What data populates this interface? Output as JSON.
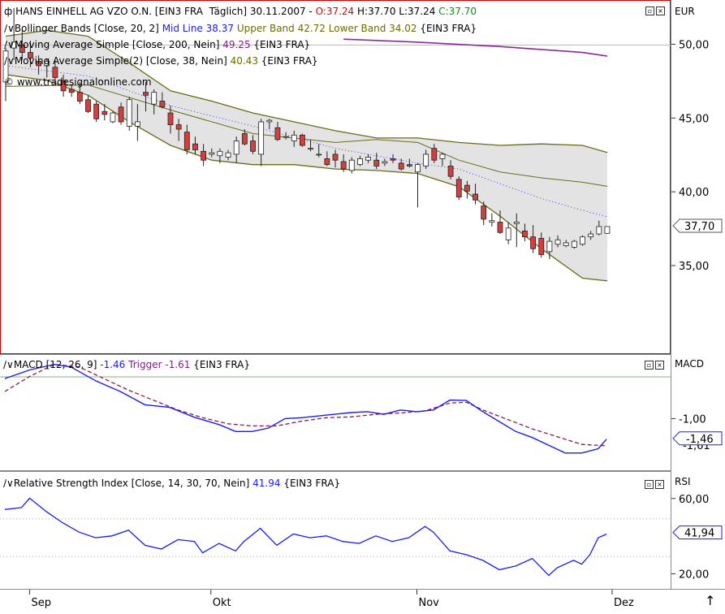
{
  "price_panel": {
    "title_symbol": "HANS EINHELL AG VZO O.N. [EIN3 FRA  Täglich] 30.11.2007 - ",
    "open": "O:37.24",
    "high_low": "H:37.70 L:37.24",
    "close": "C:37.70",
    "bb_label": "Bollinger Bands [Close, 20, 2]",
    "bb_mid": "Mid Line 38.37",
    "bb_upper_lower": "Upper Band 42.72 Lower Band 34.02",
    "bb_suffix": "{EIN3 FRA}",
    "ma200_label": "Moving Average Simple [Close, 200, Nein]",
    "ma200_value": "49.25",
    "ma200_suffix": "{EIN3 FRA}",
    "ma38_label": "Moving Average Simple(2) [Close, 38, Nein]",
    "ma38_value": "40.43",
    "ma38_suffix": "{EIN3 FRA}",
    "copyright": "© www.tradesignalonline.com",
    "axis_unit": "EUR",
    "ticks": [
      "50,00",
      "45,00",
      "40,00",
      "35,00"
    ],
    "last_price": "37,70"
  },
  "macd_panel": {
    "label": "MACD [12, 26, 9]",
    "macd_value": "-1.46",
    "trigger_label": "Trigger",
    "trigger_value": "-1.61",
    "suffix": "{EIN3 FRA}",
    "axis_unit": "MACD",
    "ticks": [
      "-1,00"
    ],
    "last_value": "-1,46",
    "hidden_value": "-1,61"
  },
  "rsi_panel": {
    "label": "Relative Strength Index [Close, 14, 30, 70, Nein]",
    "rsi_value": "41.94",
    "suffix": "{EIN3 FRA}",
    "axis_unit": "RSI",
    "ticks": [
      "60,00",
      "20,00"
    ],
    "last_value": "41,94"
  },
  "x_axis": {
    "labels": [
      "Sep",
      "Okt",
      "Nov",
      "Dez"
    ]
  },
  "colors": {
    "macd": "#1a1aff",
    "trigger": "#8a1a4a",
    "rsi": "#1a1aff",
    "band": "#6b6b1a",
    "ma200": "#8a2a9a",
    "down": "#d04040",
    "up": "#ffffff"
  },
  "chart_data": [
    {
      "type": "candlestick",
      "title": "HANS EINHELL AG VZO O.N. [EIN3 FRA  Täglich] 30.11.2007",
      "ylabel": "EUR",
      "ylim": [
        29.0,
        53.0
      ],
      "x_ticks": [
        "Sep",
        "Okt",
        "Nov",
        "Dez"
      ],
      "candles": [
        [
          47.5,
          49.8,
          46.2,
          49.6
        ],
        [
          49.8,
          52.5,
          49.0,
          50.2
        ],
        [
          50.0,
          51.0,
          49.0,
          49.5
        ],
        [
          49.5,
          50.3,
          48.5,
          49.1
        ],
        [
          48.9,
          49.3,
          48.0,
          48.6
        ],
        [
          48.6,
          49.1,
          47.8,
          48.9
        ],
        [
          48.5,
          49.0,
          47.5,
          47.8
        ],
        [
          47.6,
          48.0,
          46.5,
          46.9
        ],
        [
          47.0,
          47.3,
          46.5,
          46.8
        ],
        [
          46.8,
          47.5,
          46.0,
          46.2
        ],
        [
          46.3,
          46.6,
          45.4,
          45.5
        ],
        [
          46.0,
          46.2,
          44.8,
          45.0
        ],
        [
          45.5,
          46.0,
          44.9,
          45.3
        ],
        [
          44.8,
          45.5,
          44.7,
          45.4
        ],
        [
          45.8,
          46.1,
          44.6,
          44.8
        ],
        [
          44.5,
          46.5,
          44.2,
          46.3
        ],
        [
          44.5,
          46.0,
          43.5,
          44.8
        ],
        [
          46.8,
          47.5,
          45.5,
          46.6
        ],
        [
          46.0,
          47.0,
          45.3,
          46.8
        ],
        [
          46.2,
          46.8,
          45.7,
          45.8
        ],
        [
          45.4,
          45.9,
          44.0,
          44.6
        ],
        [
          44.6,
          45.0,
          43.5,
          44.3
        ],
        [
          44.1,
          44.6,
          42.6,
          42.9
        ],
        [
          43.3,
          43.8,
          42.6,
          42.9
        ],
        [
          42.8,
          43.3,
          41.8,
          42.2
        ],
        [
          42.6,
          43.0,
          42.4,
          42.7
        ],
        [
          42.5,
          43.0,
          42.0,
          42.8
        ],
        [
          42.4,
          42.9,
          42.2,
          42.7
        ],
        [
          42.6,
          43.8,
          42.0,
          43.5
        ],
        [
          44.0,
          44.3,
          43.2,
          43.3
        ],
        [
          43.5,
          43.9,
          42.6,
          42.8
        ],
        [
          42.6,
          45.0,
          41.8,
          44.8
        ],
        [
          44.8,
          45.0,
          44.3,
          44.9
        ],
        [
          44.4,
          44.8,
          43.5,
          43.6
        ],
        [
          43.8,
          44.1,
          43.6,
          43.8
        ],
        [
          43.5,
          44.2,
          43.1,
          43.9
        ],
        [
          43.9,
          44.0,
          43.1,
          43.2
        ],
        [
          43.0,
          43.6,
          42.8,
          43.0
        ],
        [
          42.6,
          43.3,
          42.4,
          42.6
        ],
        [
          42.3,
          42.8,
          41.8,
          41.9
        ],
        [
          42.6,
          42.9,
          41.7,
          42.2
        ],
        [
          42.1,
          42.6,
          41.4,
          41.6
        ],
        [
          41.5,
          42.4,
          41.3,
          42.2
        ],
        [
          41.9,
          42.5,
          41.8,
          42.3
        ],
        [
          42.2,
          42.6,
          42.0,
          42.4
        ],
        [
          42.2,
          42.7,
          41.6,
          41.8
        ],
        [
          42.0,
          42.3,
          41.8,
          42.1
        ],
        [
          42.3,
          42.6,
          42.0,
          42.2
        ],
        [
          42.0,
          42.3,
          41.5,
          41.6
        ],
        [
          41.9,
          42.3,
          41.7,
          41.8
        ],
        [
          41.4,
          42.0,
          39.0,
          41.9
        ],
        [
          41.8,
          42.9,
          41.6,
          42.6
        ],
        [
          43.0,
          43.3,
          42.0,
          42.2
        ],
        [
          42.3,
          42.7,
          41.8,
          42.6
        ],
        [
          41.8,
          42.2,
          40.9,
          41.1
        ],
        [
          40.9,
          41.1,
          39.5,
          39.7
        ],
        [
          40.5,
          40.8,
          39.6,
          40.1
        ],
        [
          39.9,
          40.6,
          39.2,
          39.5
        ],
        [
          39.1,
          39.4,
          37.8,
          38.2
        ],
        [
          38.0,
          38.6,
          37.7,
          38.1
        ],
        [
          38.0,
          38.8,
          37.2,
          37.3
        ],
        [
          36.8,
          38.0,
          36.5,
          37.6
        ],
        [
          37.9,
          38.6,
          36.3,
          38.0
        ],
        [
          37.4,
          37.9,
          36.7,
          37.0
        ],
        [
          37.0,
          37.8,
          35.9,
          36.2
        ],
        [
          36.9,
          37.3,
          35.6,
          35.8
        ],
        [
          36.0,
          37.0,
          35.5,
          36.7
        ],
        [
          36.5,
          37.1,
          36.3,
          36.8
        ],
        [
          36.4,
          36.8,
          36.3,
          36.6
        ],
        [
          36.3,
          36.8,
          36.2,
          36.7
        ],
        [
          36.5,
          37.1,
          36.4,
          37.0
        ],
        [
          37.0,
          37.4,
          36.8,
          37.2
        ],
        [
          37.2,
          38.1,
          37.1,
          37.7
        ],
        [
          37.24,
          37.7,
          37.24,
          37.7
        ]
      ],
      "series": [
        {
          "name": "Bollinger Upper Band",
          "values": [
            [
              0,
              50.6
            ],
            [
              5,
              51.0
            ],
            [
              10,
              50.6
            ],
            [
              15,
              48.8
            ],
            [
              20,
              46.9
            ],
            [
              25,
              46.2
            ],
            [
              30,
              45.4
            ],
            [
              35,
              44.8
            ],
            [
              40,
              44.2
            ],
            [
              45,
              43.7
            ],
            [
              50,
              43.7
            ],
            [
              55,
              43.4
            ],
            [
              60,
              43.2
            ],
            [
              65,
              43.3
            ],
            [
              70,
              43.2
            ],
            [
              73,
              42.72
            ]
          ]
        },
        {
          "name": "Bollinger Lower Band",
          "values": [
            [
              0,
              48.0
            ],
            [
              5,
              47.6
            ],
            [
              10,
              46.6
            ],
            [
              15,
              44.8
            ],
            [
              20,
              43.2
            ],
            [
              25,
              42.2
            ],
            [
              30,
              41.9
            ],
            [
              35,
              41.9
            ],
            [
              40,
              41.6
            ],
            [
              45,
              41.5
            ],
            [
              50,
              41.3
            ],
            [
              55,
              40.4
            ],
            [
              60,
              38.4
            ],
            [
              65,
              36.2
            ],
            [
              70,
              34.2
            ],
            [
              73,
              34.02
            ]
          ]
        },
        {
          "name": "Mid Line",
          "values": [
            [
              0,
              48.6
            ],
            [
              10,
              47.9
            ],
            [
              20,
              45.9
            ],
            [
              30,
              44.5
            ],
            [
              40,
              43.0
            ],
            [
              50,
              42.0
            ],
            [
              55,
              41.6
            ],
            [
              60,
              40.6
            ],
            [
              65,
              39.6
            ],
            [
              70,
              38.8
            ],
            [
              73,
              38.37
            ]
          ]
        },
        {
          "name": "Moving Average Simple(2)",
          "values": [
            [
              0,
              47.2
            ],
            [
              10,
              47.3
            ],
            [
              20,
              45.6
            ],
            [
              30,
              44.0
            ],
            [
              40,
              43.4
            ],
            [
              45,
              43.6
            ],
            [
              50,
              43.4
            ],
            [
              55,
              42.2
            ],
            [
              60,
              41.4
            ],
            [
              65,
              41.0
            ],
            [
              70,
              40.7
            ],
            [
              73,
              40.43
            ]
          ]
        },
        {
          "name": "Moving Average Simple",
          "values": [
            [
              41,
              50.4
            ],
            [
              50,
              50.2
            ],
            [
              60,
              49.9
            ],
            [
              70,
              49.5
            ],
            [
              73,
              49.25
            ]
          ]
        }
      ]
    },
    {
      "type": "line",
      "title": "MACD [12, 26, 9]",
      "ylabel": "MACD",
      "ylim": [
        -2.2,
        0.5
      ],
      "series": [
        {
          "name": "MACD",
          "values": [
            [
              0,
              -0.05
            ],
            [
              3,
              0.15
            ],
            [
              6,
              0.28
            ],
            [
              8,
              0.22
            ],
            [
              11,
              -0.1
            ],
            [
              14,
              -0.35
            ],
            [
              17,
              -0.66
            ],
            [
              20,
              -0.72
            ],
            [
              23,
              -0.95
            ],
            [
              26,
              -1.12
            ],
            [
              28,
              -1.28
            ],
            [
              30,
              -1.28
            ],
            [
              32,
              -1.2
            ],
            [
              34,
              -0.98
            ],
            [
              36,
              -0.96
            ],
            [
              38,
              -0.92
            ],
            [
              40,
              -0.88
            ],
            [
              42,
              -0.84
            ],
            [
              44,
              -0.82
            ],
            [
              46,
              -0.88
            ],
            [
              48,
              -0.78
            ],
            [
              50,
              -0.82
            ],
            [
              52,
              -0.78
            ],
            [
              54,
              -0.55
            ],
            [
              56,
              -0.56
            ],
            [
              58,
              -0.82
            ],
            [
              60,
              -1.05
            ],
            [
              62,
              -1.28
            ],
            [
              64,
              -1.42
            ],
            [
              66,
              -1.6
            ],
            [
              68,
              -1.78
            ],
            [
              70,
              -1.78
            ],
            [
              72,
              -1.68
            ],
            [
              73,
              -1.46
            ]
          ]
        },
        {
          "name": "Trigger",
          "values": [
            [
              0,
              -0.35
            ],
            [
              3,
              0.0
            ],
            [
              6,
              0.28
            ],
            [
              9,
              0.22
            ],
            [
              12,
              -0.05
            ],
            [
              15,
              -0.32
            ],
            [
              18,
              -0.55
            ],
            [
              21,
              -0.78
            ],
            [
              24,
              -0.96
            ],
            [
              27,
              -1.1
            ],
            [
              30,
              -1.15
            ],
            [
              33,
              -1.15
            ],
            [
              36,
              -1.04
            ],
            [
              39,
              -0.96
            ],
            [
              42,
              -0.94
            ],
            [
              45,
              -0.88
            ],
            [
              48,
              -0.85
            ],
            [
              51,
              -0.8
            ],
            [
              54,
              -0.62
            ],
            [
              56,
              -0.6
            ],
            [
              58,
              -0.78
            ],
            [
              61,
              -1.0
            ],
            [
              64,
              -1.22
            ],
            [
              67,
              -1.4
            ],
            [
              70,
              -1.58
            ],
            [
              73,
              -1.61
            ]
          ]
        }
      ]
    },
    {
      "type": "line",
      "title": "Relative Strength Index [Close, 14, 30, 70, Nein]",
      "ylabel": "RSI",
      "ylim": [
        12,
        75
      ],
      "series": [
        {
          "name": "RSI",
          "values": [
            [
              0,
              55
            ],
            [
              2,
              56
            ],
            [
              3,
              61
            ],
            [
              5,
              54
            ],
            [
              7,
              48
            ],
            [
              9,
              43
            ],
            [
              11,
              40
            ],
            [
              13,
              41
            ],
            [
              15,
              44
            ],
            [
              17,
              36
            ],
            [
              19,
              34
            ],
            [
              21,
              39
            ],
            [
              23,
              38
            ],
            [
              24,
              32
            ],
            [
              26,
              37
            ],
            [
              28,
              33
            ],
            [
              29,
              38
            ],
            [
              31,
              45
            ],
            [
              33,
              36
            ],
            [
              35,
              42
            ],
            [
              37,
              40
            ],
            [
              39,
              41
            ],
            [
              41,
              38
            ],
            [
              43,
              37
            ],
            [
              45,
              41
            ],
            [
              47,
              38
            ],
            [
              49,
              40
            ],
            [
              51,
              46
            ],
            [
              52,
              43
            ],
            [
              54,
              33
            ],
            [
              56,
              31
            ],
            [
              58,
              28
            ],
            [
              60,
              23
            ],
            [
              62,
              25
            ],
            [
              64,
              29
            ],
            [
              66,
              20
            ],
            [
              67,
              24
            ],
            [
              69,
              28
            ],
            [
              70,
              26
            ],
            [
              71,
              31
            ],
            [
              72,
              40
            ],
            [
              73,
              41.94
            ]
          ]
        }
      ]
    }
  ]
}
